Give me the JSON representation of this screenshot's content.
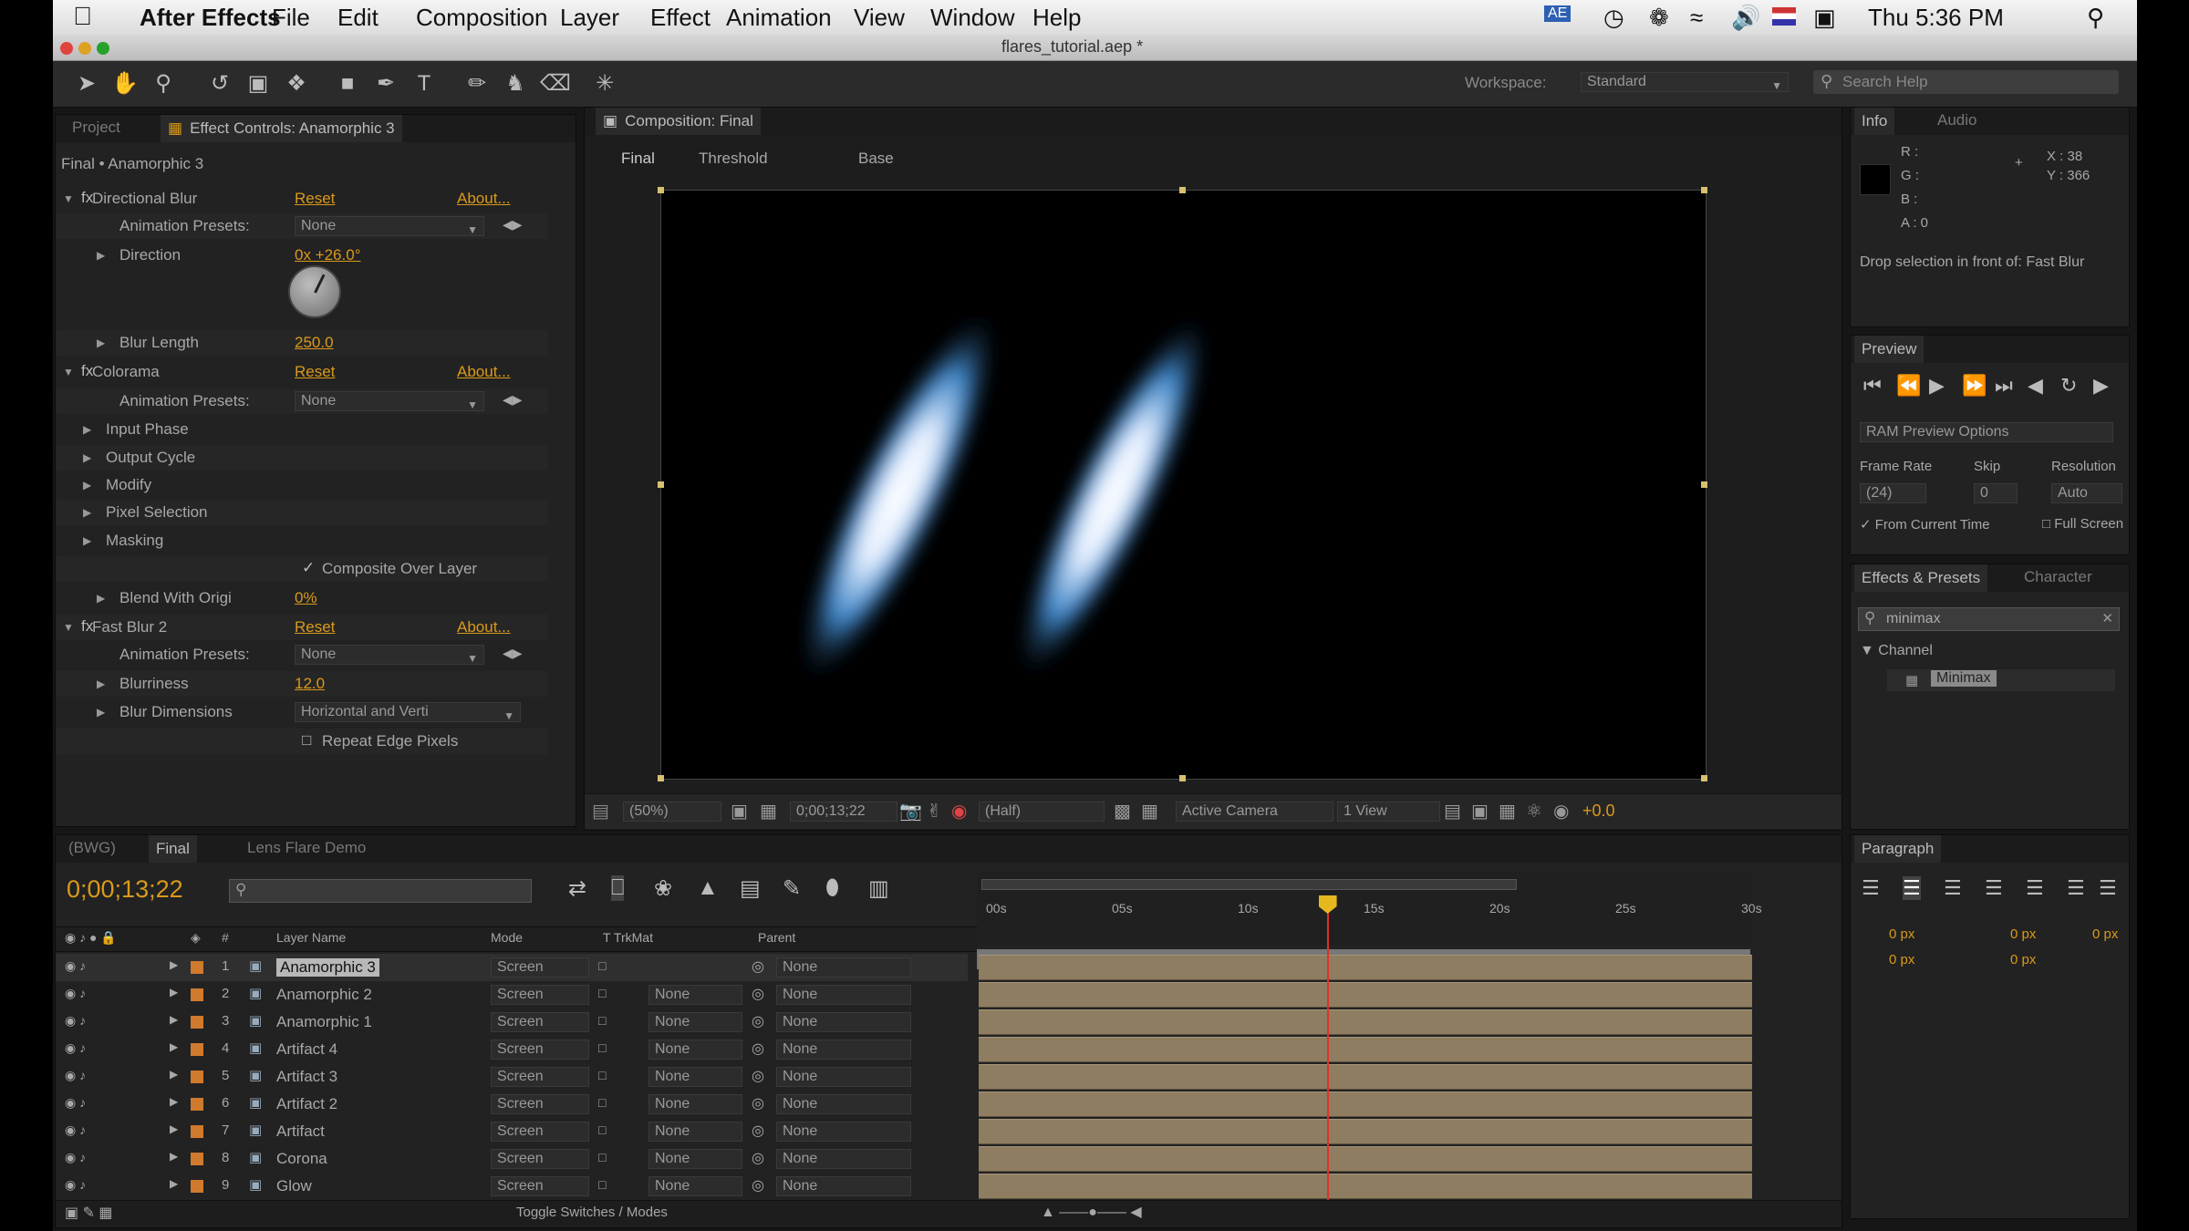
{
  "menubar": {
    "app_name": "After Effects",
    "items": [
      "File",
      "Edit",
      "Composition",
      "Layer",
      "Effect",
      "Animation",
      "View",
      "Window",
      "Help"
    ],
    "clock": "Thu 5:36 PM"
  },
  "window": {
    "title": "flares_tutorial.aep *"
  },
  "toolbar": {
    "workspace_label": "Workspace:",
    "workspace_value": "Standard",
    "search_placeholder": "Search Help"
  },
  "effect_controls": {
    "tab_project": "Project",
    "tab_effect": "Effect Controls: Anamorphic 3",
    "breadcrumb": "Final • Anamorphic 3",
    "rows": [
      {
        "label": "Directional Blur",
        "value": "Reset",
        "extra": "About..."
      },
      {
        "label": "Animation Presets:",
        "value": "None"
      },
      {
        "label": "Direction",
        "value": "0x +26.0°"
      },
      {
        "label": "Blur Length",
        "value": "250.0"
      },
      {
        "label": "Colorama",
        "value": "Reset",
        "extra": "About..."
      },
      {
        "label": "Animation Presets:",
        "value": "None"
      },
      {
        "label": "Input Phase",
        "value": ""
      },
      {
        "label": "Output Cycle",
        "value": ""
      },
      {
        "label": "Modify",
        "value": ""
      },
      {
        "label": "Pixel Selection",
        "value": ""
      },
      {
        "label": "Masking",
        "value": ""
      },
      {
        "label": "",
        "value": "Composite Over Layer"
      },
      {
        "label": "Blend With Origi",
        "value": "0%"
      },
      {
        "label": "Fast Blur 2",
        "value": "Reset",
        "extra": "About..."
      },
      {
        "label": "Animation Presets:",
        "value": "None"
      },
      {
        "label": "Blurriness",
        "value": "12.0"
      },
      {
        "label": "Blur Dimensions",
        "value": "Horizontal and Verti"
      },
      {
        "label": "",
        "value": "Repeat Edge Pixels"
      }
    ]
  },
  "composition": {
    "tab": "Composition: Final",
    "view_tabs": [
      "Final",
      "Threshold",
      "Base"
    ],
    "footer": {
      "zoom": "(50%)",
      "timecode": "0;00;13;22",
      "resolution": "(Half)",
      "camera": "Active Camera",
      "views": "1 View",
      "exposure": "+0.0"
    }
  },
  "info": {
    "tabs": [
      "Info",
      "Audio"
    ],
    "rgba": [
      "R :",
      "G :",
      "B :",
      "A : 0"
    ],
    "coords": [
      "X : 38",
      "Y : 366"
    ],
    "message": "Drop selection in front of: Fast Blur"
  },
  "preview": {
    "tab": "Preview",
    "options": "RAM Preview Options",
    "frame_rate_label": "Frame Rate",
    "skip_label": "Skip",
    "resolution_label": "Resolution",
    "frame_rate": "(24)",
    "skip": "0",
    "resolution": "Auto",
    "from_current": "From Current Time",
    "full_screen": "Full Screen"
  },
  "effects_presets": {
    "tabs": [
      "Effects & Presets",
      "Character"
    ],
    "search": "minimax",
    "category": "Channel",
    "item": "Minimax"
  },
  "paragraph": {
    "tab": "Paragraph",
    "px": [
      "0 px",
      "0 px",
      "0 px",
      "0 px",
      "0 px"
    ]
  },
  "timeline": {
    "tabs": [
      "(BWG)",
      "Final",
      "Lens Flare Demo"
    ],
    "timecode": "0;00;13;22",
    "search_placeholder": "",
    "col_headers": [
      "#",
      "Layer Name",
      "Mode",
      "T TrkMat",
      "Parent"
    ],
    "ruler": [
      "00s",
      "05s",
      "10s",
      "15s",
      "20s",
      "25s",
      "30s"
    ],
    "layers": [
      {
        "num": "1",
        "name": "Anamorphic 3",
        "mode": "Screen",
        "trkmat": "",
        "parent": "None",
        "color": "#d07a2e"
      },
      {
        "num": "2",
        "name": "Anamorphic 2",
        "mode": "Screen",
        "trkmat": "None",
        "parent": "None",
        "color": "#d07a2e"
      },
      {
        "num": "3",
        "name": "Anamorphic 1",
        "mode": "Screen",
        "trkmat": "None",
        "parent": "None",
        "color": "#d07a2e"
      },
      {
        "num": "4",
        "name": "Artifact 4",
        "mode": "Screen",
        "trkmat": "None",
        "parent": "None",
        "color": "#d07a2e"
      },
      {
        "num": "5",
        "name": "Artifact 3",
        "mode": "Screen",
        "trkmat": "None",
        "parent": "None",
        "color": "#d07a2e"
      },
      {
        "num": "6",
        "name": "Artifact 2",
        "mode": "Screen",
        "trkmat": "None",
        "parent": "None",
        "color": "#d07a2e"
      },
      {
        "num": "7",
        "name": "Artifact",
        "mode": "Screen",
        "trkmat": "None",
        "parent": "None",
        "color": "#d07a2e"
      },
      {
        "num": "8",
        "name": "Corona",
        "mode": "Screen",
        "trkmat": "None",
        "parent": "None",
        "color": "#d07a2e"
      },
      {
        "num": "9",
        "name": "Glow",
        "mode": "Screen",
        "trkmat": "None",
        "parent": "None",
        "color": "#d07a2e"
      }
    ],
    "footer_toggle": "Toggle Switches / Modes",
    "playhead_fraction": 0.45
  },
  "colors": {
    "accent": "#d99a1a",
    "glow": "#4d8cc8",
    "playhead": "#e0302a",
    "clip": "#8e7d60"
  }
}
